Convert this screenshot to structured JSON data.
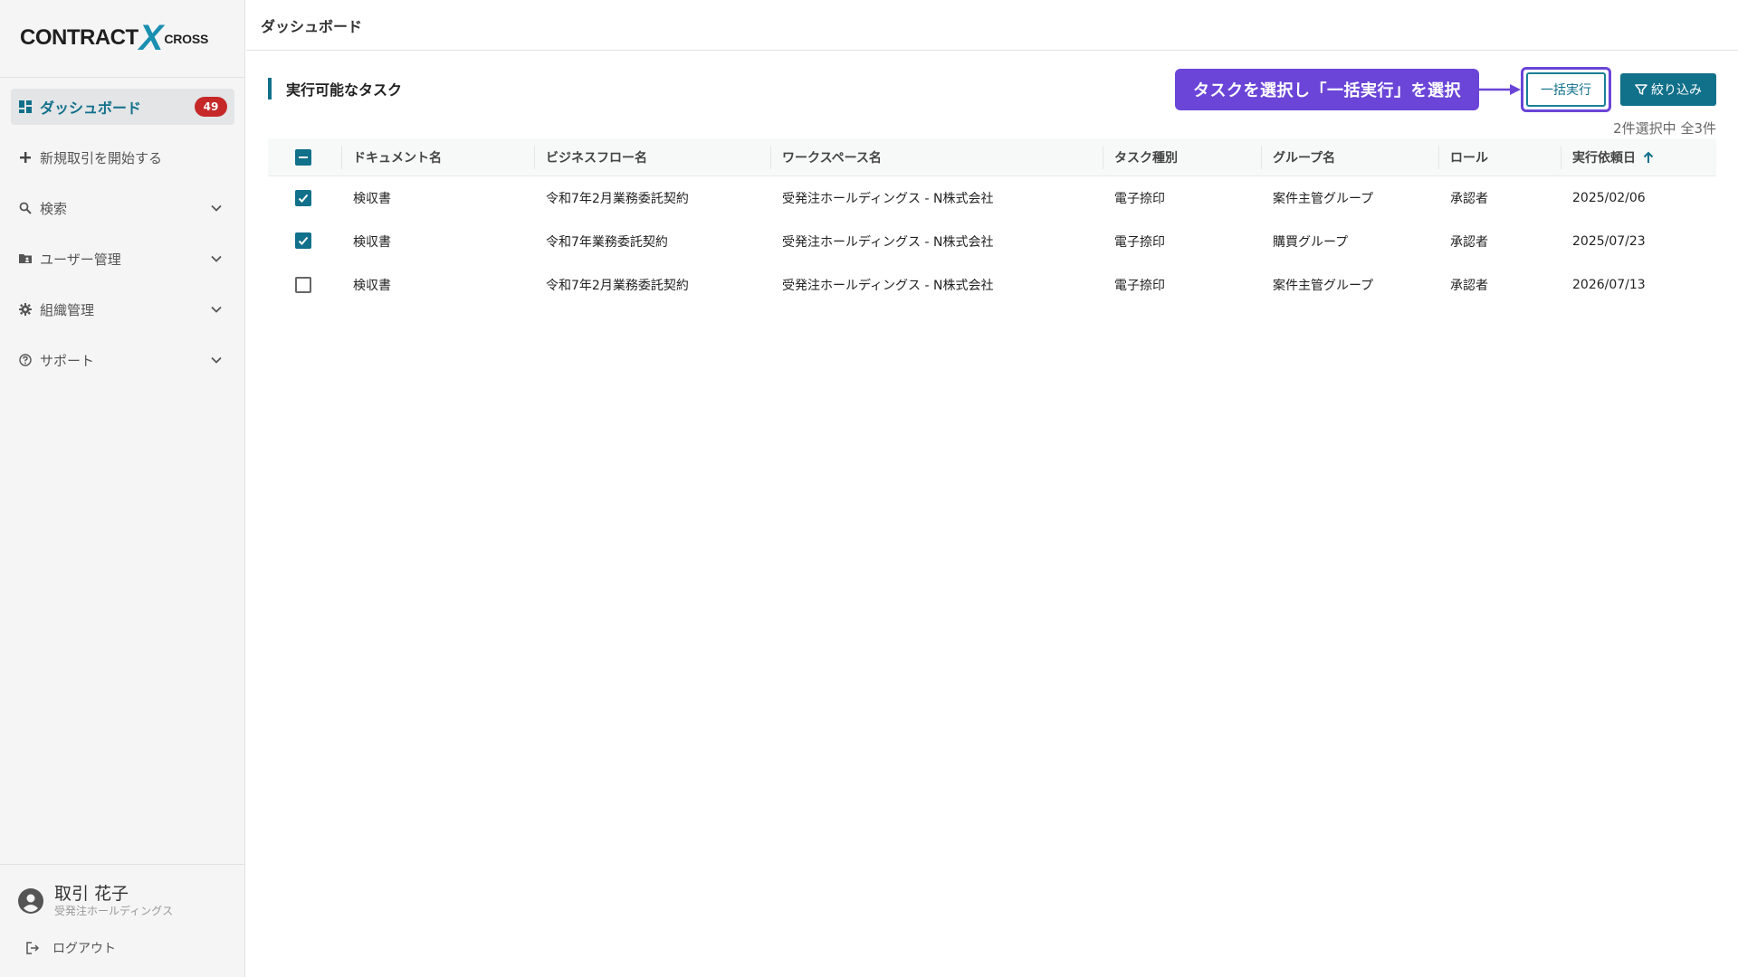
{
  "logo": {
    "main": "CONTRACT",
    "x": "X",
    "sub": "CROSS"
  },
  "sidebar": {
    "items": [
      {
        "label": "ダッシュボード",
        "badge": "49",
        "icon": "dashboard-icon",
        "active": true
      },
      {
        "label": "新規取引を開始する",
        "icon": "plus-icon"
      },
      {
        "label": "検索",
        "icon": "search-icon"
      },
      {
        "label": "ユーザー管理",
        "icon": "folder-user-icon"
      },
      {
        "label": "組織管理",
        "icon": "gear-icon"
      },
      {
        "label": "サポート",
        "icon": "help-circle-icon"
      }
    ]
  },
  "user": {
    "name": "取引 花子",
    "org": "受発注ホールディングス"
  },
  "logout": {
    "label": "ログアウト"
  },
  "header": {
    "title": "ダッシュボード"
  },
  "section": {
    "title": "実行可能なタスク"
  },
  "callout": {
    "text": "タスクを選択し「一括実行」を選択"
  },
  "toolbar": {
    "bulk_label": "一括実行",
    "filter_label": "絞り込み",
    "selection": "2件選択中 全3件"
  },
  "table": {
    "columns": [
      "ドキュメント名",
      "ビジネスフロー名",
      "ワークスペース名",
      "タスク種別",
      "グループ名",
      "ロール",
      "実行依頼日"
    ],
    "rows": [
      {
        "checked": true,
        "document": "検収書",
        "flow": "令和7年2月業務委託契約",
        "workspace": "受発注ホールディングス - N株式会社",
        "task": "電子捺印",
        "group": "案件主管グループ",
        "role": "承認者",
        "date": "2025/02/06"
      },
      {
        "checked": true,
        "document": "検収書",
        "flow": "令和7年業務委託契約",
        "workspace": "受発注ホールディングス - N株式会社",
        "task": "電子捺印",
        "group": "購買グループ",
        "role": "承認者",
        "date": "2025/07/23"
      },
      {
        "checked": false,
        "document": "検収書",
        "flow": "令和7年2月業務委託契約",
        "workspace": "受発注ホールディングス - N株式会社",
        "task": "電子捺印",
        "group": "案件主管グループ",
        "role": "承認者",
        "date": "2026/07/13"
      }
    ]
  },
  "colors": {
    "accent": "#11708a",
    "badge": "#c62828",
    "callout": "#6a45d8"
  }
}
